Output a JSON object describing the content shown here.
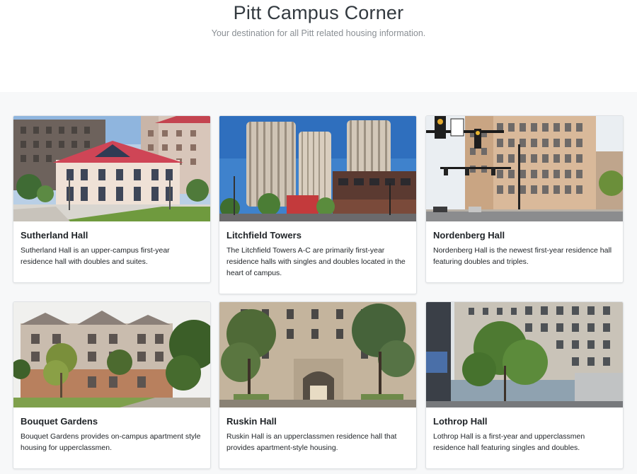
{
  "header": {
    "title": "Pitt Campus Corner",
    "subtitle": "Your destination for all Pitt related housing information."
  },
  "cards": [
    {
      "title": "Sutherland Hall",
      "text": "Sutherland Hall is an upper-campus first-year residence hall with doubles and suites.",
      "image": "sutherland-hall-photo"
    },
    {
      "title": "Litchfield Towers",
      "text": "The Litchfield Towers A-C are primarily first-year residence halls with singles and doubles located in the heart of campus.",
      "image": "litchfield-towers-photo"
    },
    {
      "title": "Nordenberg Hall",
      "text": "Nordenberg Hall is the newest first-year residence hall featuring doubles and triples.",
      "image": "nordenberg-hall-photo"
    },
    {
      "title": "Bouquet Gardens",
      "text": "Bouquet Gardens provides on-campus apartment style housing for upperclassmen.",
      "image": "bouquet-gardens-photo"
    },
    {
      "title": "Ruskin Hall",
      "text": "Ruskin Hall is an upperclassmen residence hall that provides apartment-style housing.",
      "image": "ruskin-hall-photo"
    },
    {
      "title": "Lothrop Hall",
      "text": "Lothrop Hall is a first-year and upperclassmen residence hall featuring singles and doubles.",
      "image": "lothrop-hall-photo"
    }
  ]
}
